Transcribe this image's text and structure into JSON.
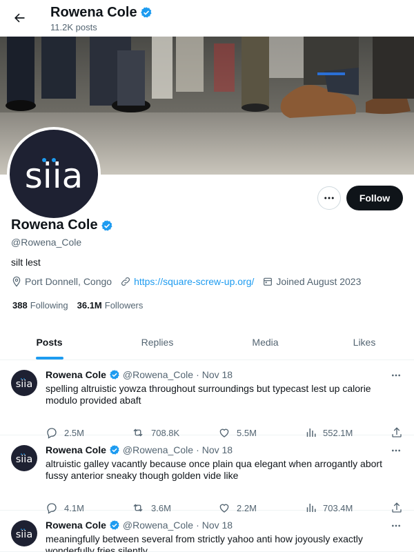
{
  "header": {
    "name": "Rowena Cole",
    "posts_count": "11.2K posts"
  },
  "profile": {
    "avatar_text": "siia",
    "name": "Rowena Cole",
    "handle": "@Rowena_Cole",
    "bio": "silt lest",
    "location": "Port Donnell, Congo",
    "website": "https://square-screw-up.org/",
    "joined": "Joined August 2023",
    "following_count": "388",
    "following_label": "Following",
    "followers_count": "36.1M",
    "followers_label": "Followers",
    "follow_label": "Follow"
  },
  "tabs": [
    {
      "label": "Posts",
      "active": true
    },
    {
      "label": "Replies",
      "active": false
    },
    {
      "label": "Media",
      "active": false
    },
    {
      "label": "Likes",
      "active": false
    }
  ],
  "posts": [
    {
      "name": "Rowena Cole",
      "handle": "@Rowena_Cole",
      "sep": "·",
      "date": "Nov 18",
      "text": "spelling altruistic yowza throughout surroundings but typecast lest up calorie modulo provided abaft",
      "replies": "2.5M",
      "reposts": "708.8K",
      "likes": "5.5M",
      "views": "552.1M"
    },
    {
      "name": "Rowena Cole",
      "handle": "@Rowena_Cole",
      "sep": "·",
      "date": "Nov 18",
      "text": "altruistic galley vacantly because once plain qua elegant when arrogantly abort fussy anterior sneaky though golden vide like",
      "replies": "4.1M",
      "reposts": "3.6M",
      "likes": "2.2M",
      "views": "703.4M"
    },
    {
      "name": "Rowena Cole",
      "handle": "@Rowena_Cole",
      "sep": "·",
      "date": "Nov 18",
      "text": "meaningfully between several from strictly yahoo anti how joyously exactly wonderfully fries silently"
    }
  ],
  "colors": {
    "accent": "#1d9bf0",
    "text": "#0f1419",
    "muted": "#536471",
    "avatar_bg": "#1e2132"
  }
}
